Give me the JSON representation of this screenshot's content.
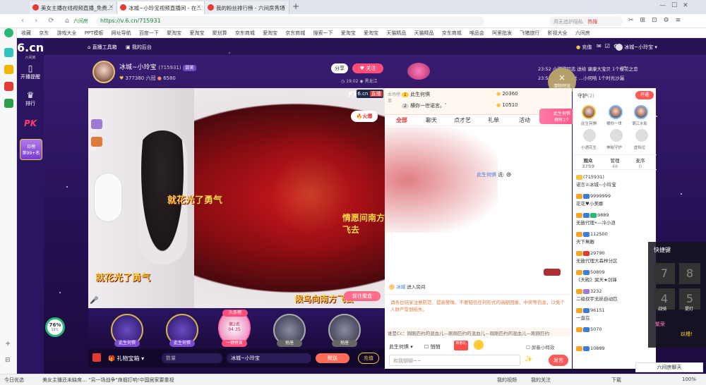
{
  "browser": {
    "tabs": [
      {
        "label": "美女主播在线视频直播_免费…",
        "active": false
      },
      {
        "label": "冰城~小玲宝视频直播间 - 在…",
        "active": true
      },
      {
        "label": "我的粉丝排行榜 - 六间房秀场",
        "active": false
      }
    ],
    "new_tab": "+",
    "site_label": "六间房",
    "url": "https://v.6.cn/715931",
    "search_placeholder": "用无追护隐私",
    "hot_badge": "热搜",
    "bookmarks_label": "收藏",
    "bookmarks": [
      "京东",
      "游戏大全",
      "PPT模板",
      "网址导航",
      "百度一下",
      "聚淘宝",
      "爱淘宝",
      "聚划算",
      "京东商城",
      "爱淘宝",
      "京东商城",
      "搜索一下",
      "爱淘宝",
      "爱淘宝",
      "天猫精品",
      "天猫精品",
      "京东商城",
      "唯品会",
      "阿里批发",
      "飞猪旅行",
      "影视大全",
      "六间房"
    ],
    "status": {
      "left": "今日优选",
      "news": "美女主播还未缺席…   \"另一场战争\"烽烟打响!中国居家要重视",
      "right": [
        "我的视频",
        "我的关注",
        "下载",
        "100%"
      ]
    }
  },
  "sidenav": {
    "logo": "6.cn",
    "logo_sub": "六间房",
    "items": [
      {
        "label": "开播提醒",
        "icon": "phone-icon"
      },
      {
        "label": "排行",
        "icon": "crown-icon"
      },
      {
        "label": "PK",
        "icon": "pk-icon"
      }
    ],
    "checkin": {
      "title": "日榜",
      "sub": "第99+名"
    }
  },
  "header": {
    "links": [
      "直播工具箱",
      "我的后台"
    ],
    "right": {
      "recharge": "充值",
      "username": "冰城~小玲宝"
    }
  },
  "anchor": {
    "name": "冰城~小玲宝",
    "room_id": "(715931)",
    "follow_tag": "甜美",
    "fans": "377380",
    "level": "六冠",
    "popularity": "6580",
    "share": "分享",
    "follow": "关注",
    "time": "19:02",
    "location": "黑龙江"
  },
  "video": {
    "brand": "6.cn",
    "live_tag": "直播",
    "hot_label": "火爆",
    "fx": "FX",
    "effect_texts": [
      "就花光了勇气",
      "就花光了勇气",
      "情愿间南方飞去",
      "候鸟向南方飞去",
      "前往魔盒"
    ],
    "mini_counts": [
      "x1",
      "x1"
    ]
  },
  "seats": [
    {
      "label": "此生何惧"
    },
    {
      "label": "此生何惧"
    },
    {
      "label": "一键榜首",
      "rank": "第2名",
      "timer": "04:35",
      "title": "头条榜"
    },
    {
      "label": "抢座"
    },
    {
      "label": "抢座"
    }
  ],
  "cpu_widget": {
    "percent": "76%",
    "temp": "55°C"
  },
  "bottom": {
    "gift_box": "礼物宝箱",
    "qty_placeholder": "数量",
    "target": "冰城~小玲宝",
    "send": "赠送",
    "recharge": "充值"
  },
  "chat": {
    "rank_label": "本场榜单",
    "ranks": [
      {
        "name": "此生何惧",
        "score": "20360"
      },
      {
        "name": "横你一世诺言。゜",
        "score": "10510"
      }
    ],
    "tabs": [
      "全部",
      "聊天",
      "点才艺",
      "礼单",
      "活动"
    ],
    "messages": [
      {
        "user": "此生何惧",
        "text": "说:"
      },
      {
        "user": "冰城",
        "text": "进入房间"
      }
    ],
    "notice": "请各位玩家注意防范、提高警惕、不要轻信任何形式的高额回报、中奖等信息，以免个人财产受到损失。",
    "ticker": "谁是Cc：刚刚匹约的混血儿—刚刚匹约的混血儿—刚刚匹约的混血儿—刚刚匹约",
    "input_user": "此生何惧",
    "private": "悄悄",
    "gift_btn": "新春礼",
    "shield": "屏蔽小特效",
    "input_placeholder": "和我聊聊~~",
    "send": "发言"
  },
  "pinned": {
    "clear_effect": "清除特效",
    "fan_badge": "此生何惧",
    "fan_count": "拥有1个",
    "news": [
      {
        "time": "23:52",
        "text": "小甜甜同志  送给 康康大宝贝  1个樱花之恋"
      },
      {
        "time": "23:52",
        "text": "此生何惧  送 …小何哈  1个时光沙漏"
      }
    ]
  },
  "guards": {
    "title": "守护",
    "count": "(2)",
    "open": "开通",
    "list": [
      "此生何惧",
      "横你一世",
      "谪江水影",
      "小酒花生",
      "神秘守护",
      "虚拟位"
    ]
  },
  "audience": {
    "tabs": [
      {
        "label": "观众",
        "count": "3759"
      },
      {
        "label": "管理",
        "count": "48"
      },
      {
        "label": "麦序",
        "count": "0"
      }
    ],
    "rows": [
      {
        "text": "(715931)"
      },
      {
        "text": "诺言♔冰城~小玲宝"
      },
      {
        "text": "9999999"
      },
      {
        "text": "花花♥小美娜"
      },
      {
        "text": "9889"
      },
      {
        "text": "无敌代理•—冷小浪"
      },
      {
        "text": "112500"
      },
      {
        "text": "天下無敵"
      },
      {
        "text": "29790"
      },
      {
        "text": "无敌代理大森林分区"
      },
      {
        "text": "50809"
      },
      {
        "text": "《天殿》冥天★剑锋"
      },
      {
        "text": "3232"
      },
      {
        "text": "二级叔宇无损自动匹"
      },
      {
        "text": "96151"
      },
      {
        "text": "一直在"
      },
      {
        "text": "5070"
      },
      {
        "text": "10889"
      }
    ],
    "footer": "六间房聊天"
  },
  "shortcut": {
    "title": "快捷键",
    "keys": [
      "7",
      "8",
      "4",
      "5"
    ],
    "labels": [
      "战骑",
      "提灯"
    ],
    "items": [
      "繁荣",
      "玖槽!"
    ]
  }
}
